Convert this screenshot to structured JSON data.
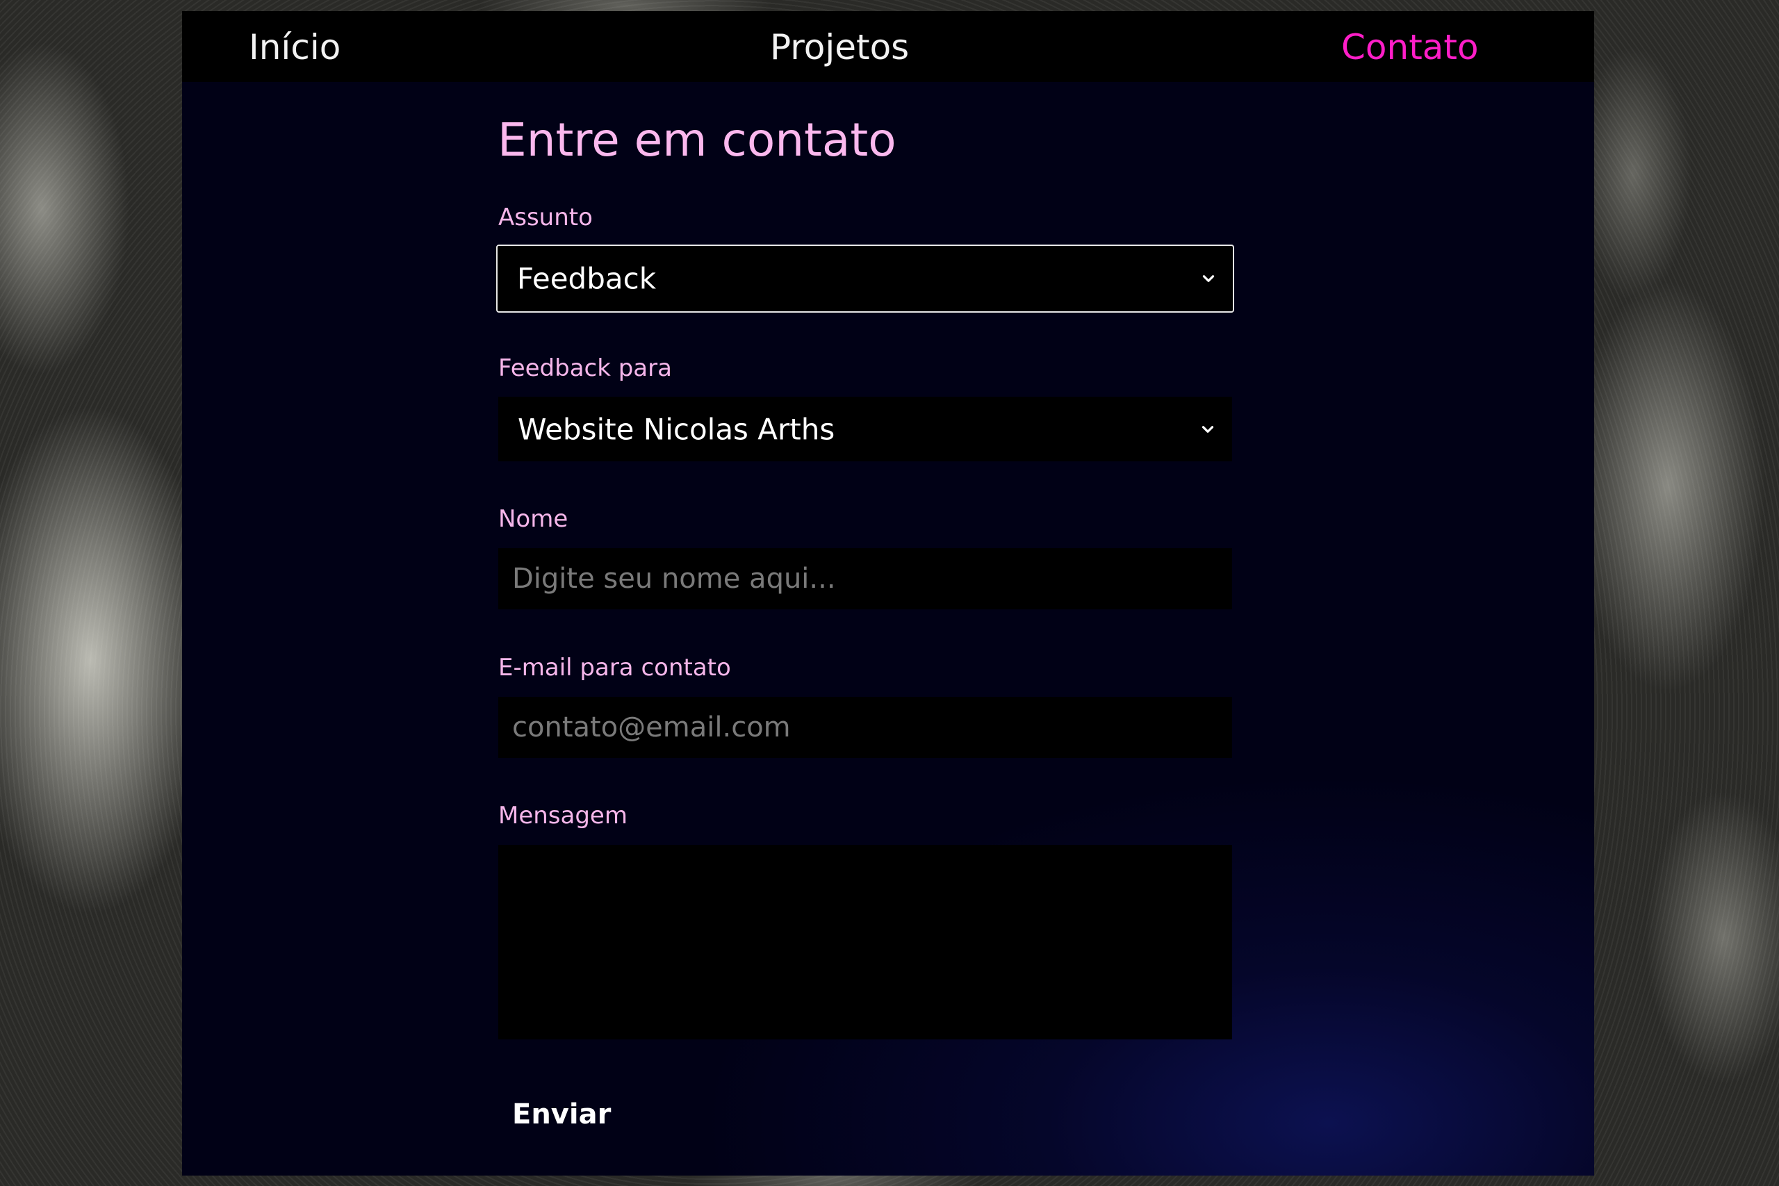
{
  "nav": {
    "home": "Início",
    "projects": "Projetos",
    "contact": "Contato"
  },
  "form": {
    "title": "Entre em contato",
    "subject": {
      "label": "Assunto",
      "value": "Feedback",
      "icon": "chevron-down-icon"
    },
    "feedback_for": {
      "label": "Feedback para",
      "value": "Website Nicolas Arths",
      "icon": "chevron-down-icon"
    },
    "name": {
      "label": "Nome",
      "placeholder": "Digite seu nome aqui..."
    },
    "email": {
      "label": "E-mail para contato",
      "placeholder": "contato@email.com"
    },
    "message": {
      "label": "Mensagem",
      "value": ""
    },
    "submit_label": "Enviar"
  },
  "colors": {
    "accent": "#ff1ec8",
    "heading_pink": "#fbb8ee",
    "label_pink": "#f5b6ea",
    "card_background": "#010116",
    "nav_background": "#000000",
    "field_background": "#000000"
  }
}
